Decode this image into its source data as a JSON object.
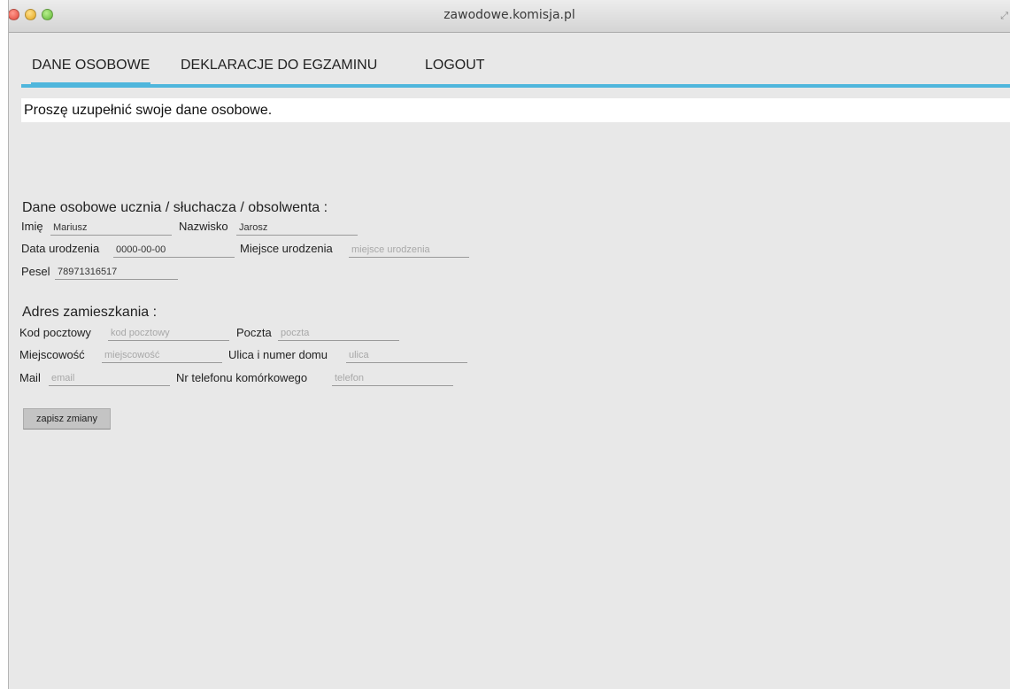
{
  "window": {
    "title": "zawodowe.komisja.pl"
  },
  "nav": {
    "items": [
      "DANE OSOBOWE",
      "DEKLARACJE DO EGZAMINU",
      "LOGOUT"
    ]
  },
  "notice": "Proszę uzupełnić swoje dane osobowe.",
  "personal": {
    "heading": "Dane osobowe ucznia / słuchacza / obsolwenta :",
    "imie_label": "Imię",
    "imie_value": "Mariusz",
    "nazwisko_label": "Nazwisko",
    "nazwisko_value": "Jarosz",
    "data_label": "Data urodzenia",
    "data_value": "0000-00-00",
    "miejsce_label": "Miejsce urodzenia",
    "miejsce_placeholder": "miejsce urodzenia",
    "pesel_label": "Pesel",
    "pesel_value": "78971316517"
  },
  "address": {
    "heading": "Adres zamieszkania :",
    "kod_label": "Kod pocztowy",
    "kod_placeholder": "kod pocztowy",
    "poczta_label": "Poczta",
    "poczta_placeholder": "poczta",
    "miejscowosc_label": "Miejscowość",
    "miejscowosc_placeholder": "miejscowość",
    "ulica_label": "Ulica i numer domu",
    "ulica_placeholder": "ulica",
    "mail_label": "Mail",
    "mail_placeholder": "email",
    "telefon_label": "Nr telefonu komórkowego",
    "telefon_placeholder": "telefon"
  },
  "save_label": "zapisz zmiany",
  "colors": {
    "accent": "#4fb6dc",
    "window_bg": "#e8e8e8"
  }
}
